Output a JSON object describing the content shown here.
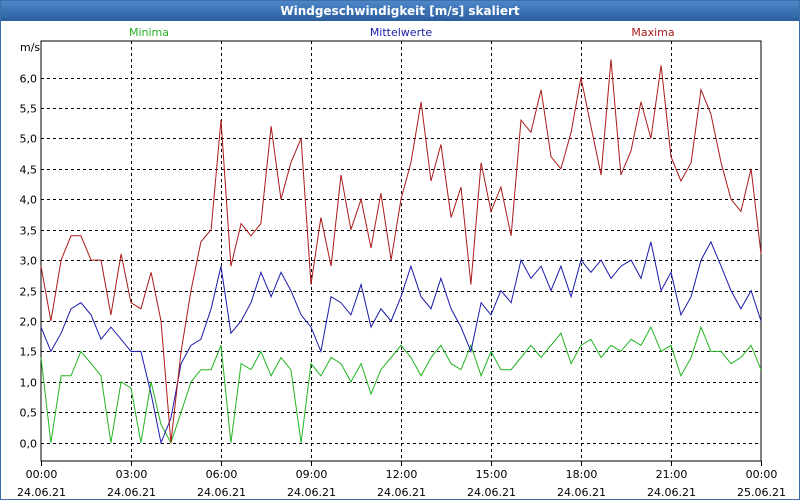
{
  "window": {
    "title": "Windgeschwindigkeit [m/s] skaliert"
  },
  "chart_data": {
    "type": "line",
    "title": "Windgeschwindigkeit [m/s] skaliert",
    "ylabel": "m/s",
    "ylim": [
      -0.3,
      6.6
    ],
    "yticks": [
      "0,0",
      "0,5",
      "1,0",
      "1,5",
      "2,0",
      "2,5",
      "3,0",
      "3,5",
      "4,0",
      "4,5",
      "5,0",
      "5,5",
      "6,0"
    ],
    "ytick_values": [
      0,
      0.5,
      1,
      1.5,
      2,
      2.5,
      3,
      3.5,
      4,
      4.5,
      5,
      5.5,
      6
    ],
    "xlim": [
      0,
      24
    ],
    "xticks": [
      {
        "time": "00:00",
        "date": "24.06.21"
      },
      {
        "time": "03:00",
        "date": "24.06.21"
      },
      {
        "time": "06:00",
        "date": "24.06.21"
      },
      {
        "time": "09:00",
        "date": "24.06.21"
      },
      {
        "time": "12:00",
        "date": "24.06.21"
      },
      {
        "time": "15:00",
        "date": "24.06.21"
      },
      {
        "time": "18:00",
        "date": "24.06.21"
      },
      {
        "time": "21:00",
        "date": "24.06.21"
      },
      {
        "time": "00:00",
        "date": "25.06.21"
      }
    ],
    "xtick_values": [
      0,
      3,
      6,
      9,
      12,
      15,
      18,
      21,
      24
    ],
    "grid": true,
    "legend_position": "top",
    "series": [
      {
        "name": "Minima",
        "color": "#22b422",
        "x": [
          0,
          0.33,
          0.67,
          1,
          1.33,
          1.67,
          2,
          2.33,
          2.67,
          3,
          3.33,
          3.67,
          4,
          4.33,
          4.67,
          5,
          5.33,
          5.67,
          6,
          6.33,
          6.67,
          7,
          7.33,
          7.67,
          8,
          8.33,
          8.67,
          9,
          9.33,
          9.67,
          10,
          10.33,
          10.67,
          11,
          11.33,
          11.67,
          12,
          12.33,
          12.67,
          13,
          13.33,
          13.67,
          14,
          14.33,
          14.67,
          15,
          15.33,
          15.67,
          16,
          16.33,
          16.67,
          17,
          17.33,
          17.67,
          18,
          18.33,
          18.67,
          19,
          19.33,
          19.67,
          20,
          20.33,
          20.67,
          21,
          21.33,
          21.67,
          22,
          22.33,
          22.67,
          23,
          23.33,
          23.67,
          24
        ],
        "y": [
          1.4,
          0,
          1.1,
          1.1,
          1.5,
          1.3,
          1.1,
          0,
          1.0,
          0.9,
          0,
          1.0,
          0.3,
          0,
          0.5,
          1.0,
          1.2,
          1.2,
          1.6,
          0,
          1.3,
          1.2,
          1.5,
          1.1,
          1.4,
          1.2,
          0,
          1.3,
          1.1,
          1.4,
          1.3,
          1.0,
          1.3,
          0.8,
          1.2,
          1.4,
          1.6,
          1.4,
          1.1,
          1.4,
          1.6,
          1.3,
          1.2,
          1.6,
          1.1,
          1.5,
          1.2,
          1.2,
          1.4,
          1.6,
          1.4,
          1.6,
          1.8,
          1.3,
          1.6,
          1.7,
          1.4,
          1.6,
          1.5,
          1.7,
          1.6,
          1.9,
          1.5,
          1.6,
          1.1,
          1.4,
          1.9,
          1.5,
          1.5,
          1.3,
          1.4,
          1.6,
          1.2
        ]
      },
      {
        "name": "Mittelwerte",
        "color": "#1a1aaa",
        "x": [
          0,
          0.33,
          0.67,
          1,
          1.33,
          1.67,
          2,
          2.33,
          2.67,
          3,
          3.33,
          3.67,
          4,
          4.33,
          4.67,
          5,
          5.33,
          5.67,
          6,
          6.33,
          6.67,
          7,
          7.33,
          7.67,
          8,
          8.33,
          8.67,
          9,
          9.33,
          9.67,
          10,
          10.33,
          10.67,
          11,
          11.33,
          11.67,
          12,
          12.33,
          12.67,
          13,
          13.33,
          13.67,
          14,
          14.33,
          14.67,
          15,
          15.33,
          15.67,
          16,
          16.33,
          16.67,
          17,
          17.33,
          17.67,
          18,
          18.33,
          18.67,
          19,
          19.33,
          19.67,
          20,
          20.33,
          20.67,
          21,
          21.33,
          21.67,
          22,
          22.33,
          22.67,
          23,
          23.33,
          23.67,
          24
        ],
        "y": [
          1.9,
          1.5,
          1.8,
          2.2,
          2.3,
          2.1,
          1.7,
          1.9,
          1.7,
          1.5,
          1.5,
          0.8,
          0,
          0.4,
          1.3,
          1.6,
          1.7,
          2.2,
          2.9,
          1.8,
          2.0,
          2.3,
          2.8,
          2.4,
          2.8,
          2.5,
          2.1,
          1.9,
          1.5,
          2.4,
          2.3,
          2.1,
          2.6,
          1.9,
          2.2,
          2.0,
          2.4,
          2.9,
          2.4,
          2.2,
          2.7,
          2.2,
          1.9,
          1.5,
          2.3,
          2.1,
          2.5,
          2.3,
          3.0,
          2.7,
          2.9,
          2.5,
          2.9,
          2.4,
          3.0,
          2.8,
          3.0,
          2.7,
          2.9,
          3.0,
          2.7,
          3.3,
          2.5,
          2.8,
          2.1,
          2.4,
          3.0,
          3.3,
          2.9,
          2.5,
          2.2,
          2.5,
          2.0
        ]
      },
      {
        "name": "Maxima",
        "color": "#aa1a1a",
        "x": [
          0,
          0.33,
          0.67,
          1,
          1.33,
          1.67,
          2,
          2.33,
          2.67,
          3,
          3.33,
          3.67,
          4,
          4.33,
          4.67,
          5,
          5.33,
          5.67,
          6,
          6.33,
          6.67,
          7,
          7.33,
          7.67,
          8,
          8.33,
          8.67,
          9,
          9.33,
          9.67,
          10,
          10.33,
          10.67,
          11,
          11.33,
          11.67,
          12,
          12.33,
          12.67,
          13,
          13.33,
          13.67,
          14,
          14.33,
          14.67,
          15,
          15.33,
          15.67,
          16,
          16.33,
          16.67,
          17,
          17.33,
          17.67,
          18,
          18.33,
          18.67,
          19,
          19.33,
          19.67,
          20,
          20.33,
          20.67,
          21,
          21.33,
          21.67,
          22,
          22.33,
          22.67,
          23,
          23.33,
          23.67,
          24
        ],
        "y": [
          2.9,
          2.0,
          3.0,
          3.4,
          3.4,
          3.0,
          3.0,
          2.1,
          3.1,
          2.3,
          2.2,
          2.8,
          2.0,
          0,
          1.5,
          2.5,
          3.3,
          3.5,
          5.3,
          2.9,
          3.6,
          3.4,
          3.6,
          5.2,
          4.0,
          4.6,
          5.0,
          2.6,
          3.7,
          2.9,
          4.4,
          3.5,
          4.0,
          3.2,
          4.1,
          3.0,
          4.0,
          4.6,
          5.6,
          4.3,
          4.9,
          3.7,
          4.2,
          2.6,
          4.6,
          3.8,
          4.2,
          3.4,
          5.3,
          5.1,
          5.8,
          4.7,
          4.5,
          5.1,
          6.0,
          5.2,
          4.4,
          6.3,
          4.4,
          4.8,
          5.6,
          5.0,
          6.2,
          4.7,
          4.3,
          4.6,
          5.8,
          5.4,
          4.6,
          4.0,
          3.8,
          4.5,
          3.1
        ]
      }
    ]
  }
}
